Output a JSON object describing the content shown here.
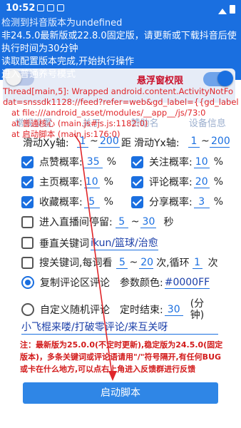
{
  "status_bar": {
    "time": "10:52"
  },
  "log": {
    "lines": [
      "检测到抖音版本为undefined",
      "非24.5.0最新版或22.8.0固定版，请更新或下载抖音后使",
      "执行时间为30分钟",
      "读取配置版本完成,开始执行操作",
      "进入普通养号模式"
    ],
    "errors": [
      "Thread[main,5]: Wrapped android.content.ActivityNotFo",
      "dat=snssdk1128://feed?refer=web&gd_label={{gd_label",
      "at file:///android_asset/modules/__app__/js/73:0",
      "at 普通核心 (main.js#js.js:1182:0)",
      "at 启动脚本 (main.js:176:0)"
    ]
  },
  "toggles": {
    "float_permission_label": "悬浮窗权限"
  },
  "tabs": [
    "常规设置",
    "关于",
    "赞助名",
    "设备信息"
  ],
  "slide": {
    "xy_label": "滑动Xy轴:",
    "xy_from": "1",
    "xy_sep": "~",
    "xy_to": "200",
    "xy_unit": "距",
    "yx_label": "滑动Yx轴:",
    "yx_from": "1",
    "yx_sep": "~",
    "yx_to": "200"
  },
  "rates": [
    {
      "left_label": "点赞概率:",
      "left_value": "35",
      "right_label": "关注概率:",
      "right_value": "10",
      "unit": "%"
    },
    {
      "left_label": "主页概率:",
      "left_value": "10",
      "right_label": "评论概率:",
      "right_value": "20",
      "unit": "%"
    },
    {
      "left_label": "收藏概率:",
      "left_value": "5",
      "right_label": "分享概率:",
      "right_value": "3",
      "unit": "%"
    }
  ],
  "live": {
    "label": "进入直播间停留:",
    "from": "5",
    "sep": "~",
    "to": "30",
    "unit": "秒"
  },
  "vertical_keywords": {
    "label": "垂直关键词",
    "value": "ikun/篮球/治愈"
  },
  "search_keywords": {
    "label": "搜关键词,每词看",
    "from": "5",
    "sep": "~",
    "to": "20",
    "suffix": "次,循环",
    "loop": "1",
    "loop_unit": "次"
  },
  "copy_comment": {
    "label": "复制评论区评论",
    "param_label": "参数颜色:",
    "param_value": "#0000FF"
  },
  "custom_comment": {
    "label": "自定义随机评论",
    "end_label": "定时结束:",
    "end_value": "30",
    "end_unit": "(分钟)"
  },
  "comment_text": "小飞棍来喽/打破零评论/来互关呀",
  "note": "注：最新版为25.0.0(不定时更新),稳定版为24.5.0(固定版本)，多条关键词或评论语请用\"/\"符号隔开,有任何BUG或卡在什么地方,可以点右上角进入反馈群进行反馈",
  "start_button": "启动脚本",
  "colors": {
    "accent": "#1a6fe0",
    "error": "#e0262a",
    "note": "#d21a1a"
  }
}
